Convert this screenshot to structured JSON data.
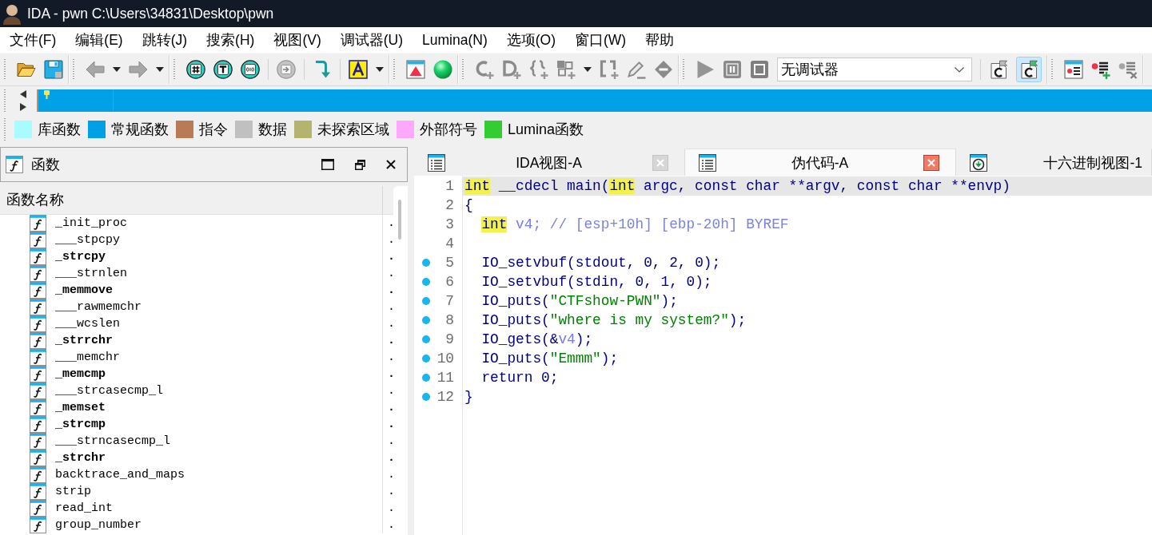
{
  "window": {
    "title": "IDA - pwn C:\\Users\\34831\\Desktop\\pwn"
  },
  "menu": [
    "文件(F)",
    "编辑(E)",
    "跳转(J)",
    "搜索(H)",
    "视图(V)",
    "调试器(U)",
    "Lumina(N)",
    "选项(O)",
    "窗口(W)",
    "帮助"
  ],
  "toolbar": {
    "groups": [
      {
        "sections": [
          {
            "items": [
              {
                "kind": "open",
                "disabled": false
              },
              {
                "kind": "save",
                "disabled": false
              }
            ]
          }
        ]
      },
      {
        "sections": [
          {
            "items": [
              {
                "kind": "back",
                "disabled": true
              },
              {
                "kind": "menu",
                "disabled": false
              },
              {
                "kind": "forward",
                "disabled": true
              },
              {
                "kind": "menu",
                "disabled": false
              }
            ]
          }
        ]
      },
      {
        "sections": [
          {
            "items": [
              {
                "kind": "hash",
                "disabled": false
              },
              {
                "kind": "text",
                "disabled": false
              },
              {
                "kind": "binary",
                "disabled": false
              }
            ]
          },
          {
            "items": [
              {
                "kind": "jump",
                "disabled": true
              }
            ]
          },
          {
            "items": [
              {
                "kind": "hook",
                "disabled": false
              }
            ]
          },
          {
            "items": [
              {
                "kind": "letter",
                "disabled": false
              },
              {
                "kind": "menu",
                "disabled": false
              }
            ]
          }
        ]
      },
      {
        "sections": [
          {
            "items": [
              {
                "kind": "window",
                "disabled": false
              },
              {
                "kind": "ball",
                "disabled": false
              }
            ]
          }
        ]
      },
      {
        "sections": [
          {
            "items": [
              {
                "kind": "c-plus",
                "disabled": true
              },
              {
                "kind": "d-plus",
                "disabled": true
              },
              {
                "kind": "braces-plus",
                "disabled": true
              },
              {
                "kind": "grid-plus",
                "disabled": true
              },
              {
                "kind": "menu",
                "disabled": false
              },
              {
                "kind": "brackets-plus",
                "disabled": true
              },
              {
                "kind": "pencil",
                "disabled": true
              },
              {
                "kind": "diamond",
                "disabled": true
              }
            ]
          }
        ]
      },
      {
        "sections": [
          {
            "items": [
              {
                "kind": "play",
                "disabled": true
              },
              {
                "kind": "pause",
                "disabled": true
              },
              {
                "kind": "stop",
                "disabled": true
              },
              {
                "kind": "select",
                "disabled": false,
                "value": "无调试器"
              }
            ]
          },
          {
            "items": [
              {
                "kind": "c-flag",
                "disabled": false,
                "selected": false
              },
              {
                "kind": "c-flag",
                "disabled": false,
                "selected": true
              }
            ]
          }
        ]
      },
      {
        "sections": [
          {
            "items": [
              {
                "kind": "dot-list",
                "disabled": false
              },
              {
                "kind": "dot-list-plus",
                "disabled": false
              },
              {
                "kind": "dot-list-cross",
                "disabled": true
              }
            ]
          }
        ]
      }
    ]
  },
  "legend": [
    {
      "label": "库函数",
      "color": "#a8fbff"
    },
    {
      "label": "常规函数",
      "color": "#00a0e6"
    },
    {
      "label": "指令",
      "color": "#b97a57"
    },
    {
      "label": "数据",
      "color": "#c0c0c0"
    },
    {
      "label": "未探索区域",
      "color": "#b4b46e"
    },
    {
      "label": "外部符号",
      "color": "#ffa8ff"
    },
    {
      "label": "Lumina函数",
      "color": "#33cc33"
    }
  ],
  "functions_panel": {
    "title": "函数",
    "columns": [
      "函数名称"
    ],
    "rows": [
      {
        "name": "_init_proc",
        "bold": false,
        "column_2": "."
      },
      {
        "name": "___stpcpy",
        "bold": false,
        "column_2": "."
      },
      {
        "name": "_strcpy",
        "bold": true,
        "column_2": "."
      },
      {
        "name": "___strnlen",
        "bold": false,
        "column_2": "."
      },
      {
        "name": "_memmove",
        "bold": true,
        "column_2": "."
      },
      {
        "name": "___rawmemchr",
        "bold": false,
        "column_2": "."
      },
      {
        "name": "___wcslen",
        "bold": false,
        "column_2": "."
      },
      {
        "name": "_strrchr",
        "bold": true,
        "column_2": "."
      },
      {
        "name": "___memchr",
        "bold": false,
        "column_2": "."
      },
      {
        "name": "_memcmp",
        "bold": true,
        "column_2": "."
      },
      {
        "name": "___strcasecmp_l",
        "bold": false,
        "column_2": "."
      },
      {
        "name": "_memset",
        "bold": true,
        "column_2": "."
      },
      {
        "name": "_strcmp",
        "bold": true,
        "column_2": "."
      },
      {
        "name": "___strncasecmp_l",
        "bold": false,
        "column_2": "."
      },
      {
        "name": "_strchr",
        "bold": true,
        "column_2": "."
      },
      {
        "name": "backtrace_and_maps",
        "bold": false,
        "column_2": "."
      },
      {
        "name": "strip",
        "bold": false,
        "column_2": "."
      },
      {
        "name": "read_int",
        "bold": false,
        "column_2": "."
      },
      {
        "name": "group_number",
        "bold": false,
        "column_2": "."
      }
    ]
  },
  "editor": {
    "tabs": [
      {
        "label": "IDA视图-A",
        "kind": "listing",
        "selected": false,
        "close_button": true
      },
      {
        "label": "伪代码-A",
        "kind": "listing",
        "selected": true,
        "close_button": true
      },
      {
        "label": "十六进制视图-1",
        "kind": "hex",
        "selected": false,
        "close_button": false
      }
    ],
    "lines": [
      {
        "number": "1",
        "dot": false,
        "current": true,
        "indented": false,
        "tokens": [
          {
            "kind": "highlight",
            "text": "int"
          },
          {
            "kind": "text",
            "text": " __cdecl main("
          },
          {
            "kind": "highlight",
            "text": "int"
          },
          {
            "kind": "text",
            "text": " argc, const char **argv, const char **envp)"
          }
        ]
      },
      {
        "number": "2",
        "dot": false,
        "current": false,
        "indented": false,
        "tokens": [
          {
            "kind": "text",
            "text": "{"
          }
        ]
      },
      {
        "number": "3",
        "dot": false,
        "current": false,
        "indented": true,
        "tokens": [
          {
            "kind": "highlight",
            "text": "int"
          },
          {
            "kind": "local",
            "text": " v4"
          },
          {
            "kind": "comment",
            "text": "; // [esp+10h] [ebp-20h] BYREF"
          }
        ]
      },
      {
        "number": "4",
        "dot": false,
        "current": false
      },
      {
        "number": "5",
        "dot": true,
        "current": false,
        "indented": true,
        "tokens": [
          {
            "kind": "text",
            "text": "IO_setvbuf(stdout, 0, 2, 0);"
          }
        ]
      },
      {
        "number": "6",
        "dot": true,
        "current": false,
        "indented": true,
        "tokens": [
          {
            "kind": "text",
            "text": "IO_setvbuf(stdin, 0, 1, 0);"
          }
        ]
      },
      {
        "number": "7",
        "dot": true,
        "current": false,
        "indented": true,
        "tokens": [
          {
            "kind": "text",
            "text": "IO_puts("
          },
          {
            "kind": "string",
            "text": "\"CTFshow-PWN\""
          },
          {
            "kind": "text",
            "text": ");"
          }
        ]
      },
      {
        "number": "8",
        "dot": true,
        "current": false,
        "indented": true,
        "tokens": [
          {
            "kind": "text",
            "text": "IO_puts("
          },
          {
            "kind": "string",
            "text": "\"where is my system?\""
          },
          {
            "kind": "text",
            "text": ");"
          }
        ]
      },
      {
        "number": "9",
        "dot": true,
        "current": false,
        "indented": true,
        "tokens": [
          {
            "kind": "text",
            "text": "IO_gets(&"
          },
          {
            "kind": "local",
            "text": "v4"
          },
          {
            "kind": "text",
            "text": ");"
          }
        ]
      },
      {
        "number": "10",
        "dot": true,
        "current": false,
        "indented": true,
        "tokens": [
          {
            "kind": "text",
            "text": "IO_puts("
          },
          {
            "kind": "string",
            "text": "\"Emmm\""
          },
          {
            "kind": "text",
            "text": ");"
          }
        ]
      },
      {
        "number": "11",
        "dot": true,
        "current": false,
        "indented": true,
        "tokens": [
          {
            "kind": "text",
            "text": "return 0;"
          }
        ]
      },
      {
        "number": "12",
        "dot": true,
        "current": false,
        "indented": false,
        "tokens": [
          {
            "kind": "text",
            "text": "}"
          }
        ]
      }
    ]
  }
}
